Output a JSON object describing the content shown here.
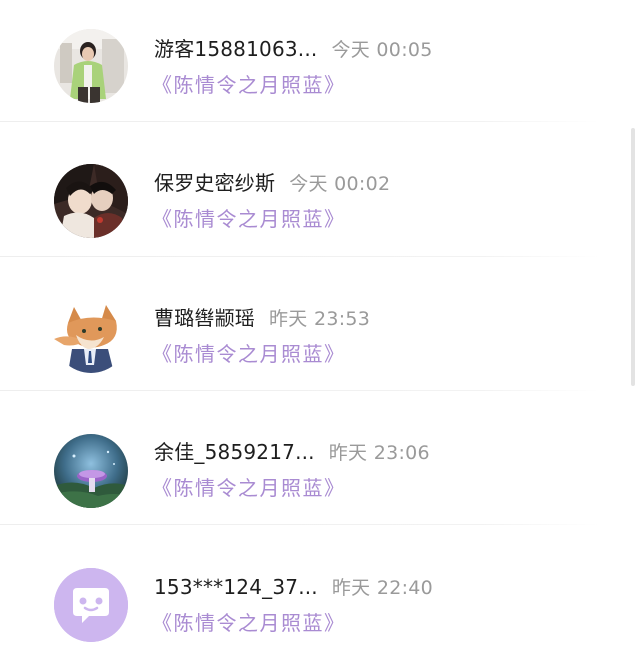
{
  "items": [
    {
      "name": "游客15881063...",
      "time": "今天 00:05",
      "book": "《陈情令之月照蓝》",
      "avatar": "photo-girl-green-jacket-icon"
    },
    {
      "name": "保罗史密纱斯",
      "time": "今天 00:02",
      "book": "《陈情令之月照蓝》",
      "avatar": "anime-couple-icon"
    },
    {
      "name": "曹璐辔颛瑶",
      "time": "昨天 23:53",
      "book": "《陈情令之月照蓝》",
      "avatar": "fox-character-icon"
    },
    {
      "name": "余佳_5859217...",
      "time": "昨天 23:06",
      "book": "《陈情令之月照蓝》",
      "avatar": "fantasy-mushroom-icon"
    },
    {
      "name": "153***124_37...",
      "time": "昨天 22:40",
      "book": "《陈情令之月照蓝》",
      "avatar": "default-chat-bubble-icon"
    }
  ],
  "colors": {
    "book_title": "#a98bd2",
    "default_avatar_bg": "#cdb6ef",
    "name_text": "#1e1e1e",
    "time_text": "#9a9a9a"
  }
}
